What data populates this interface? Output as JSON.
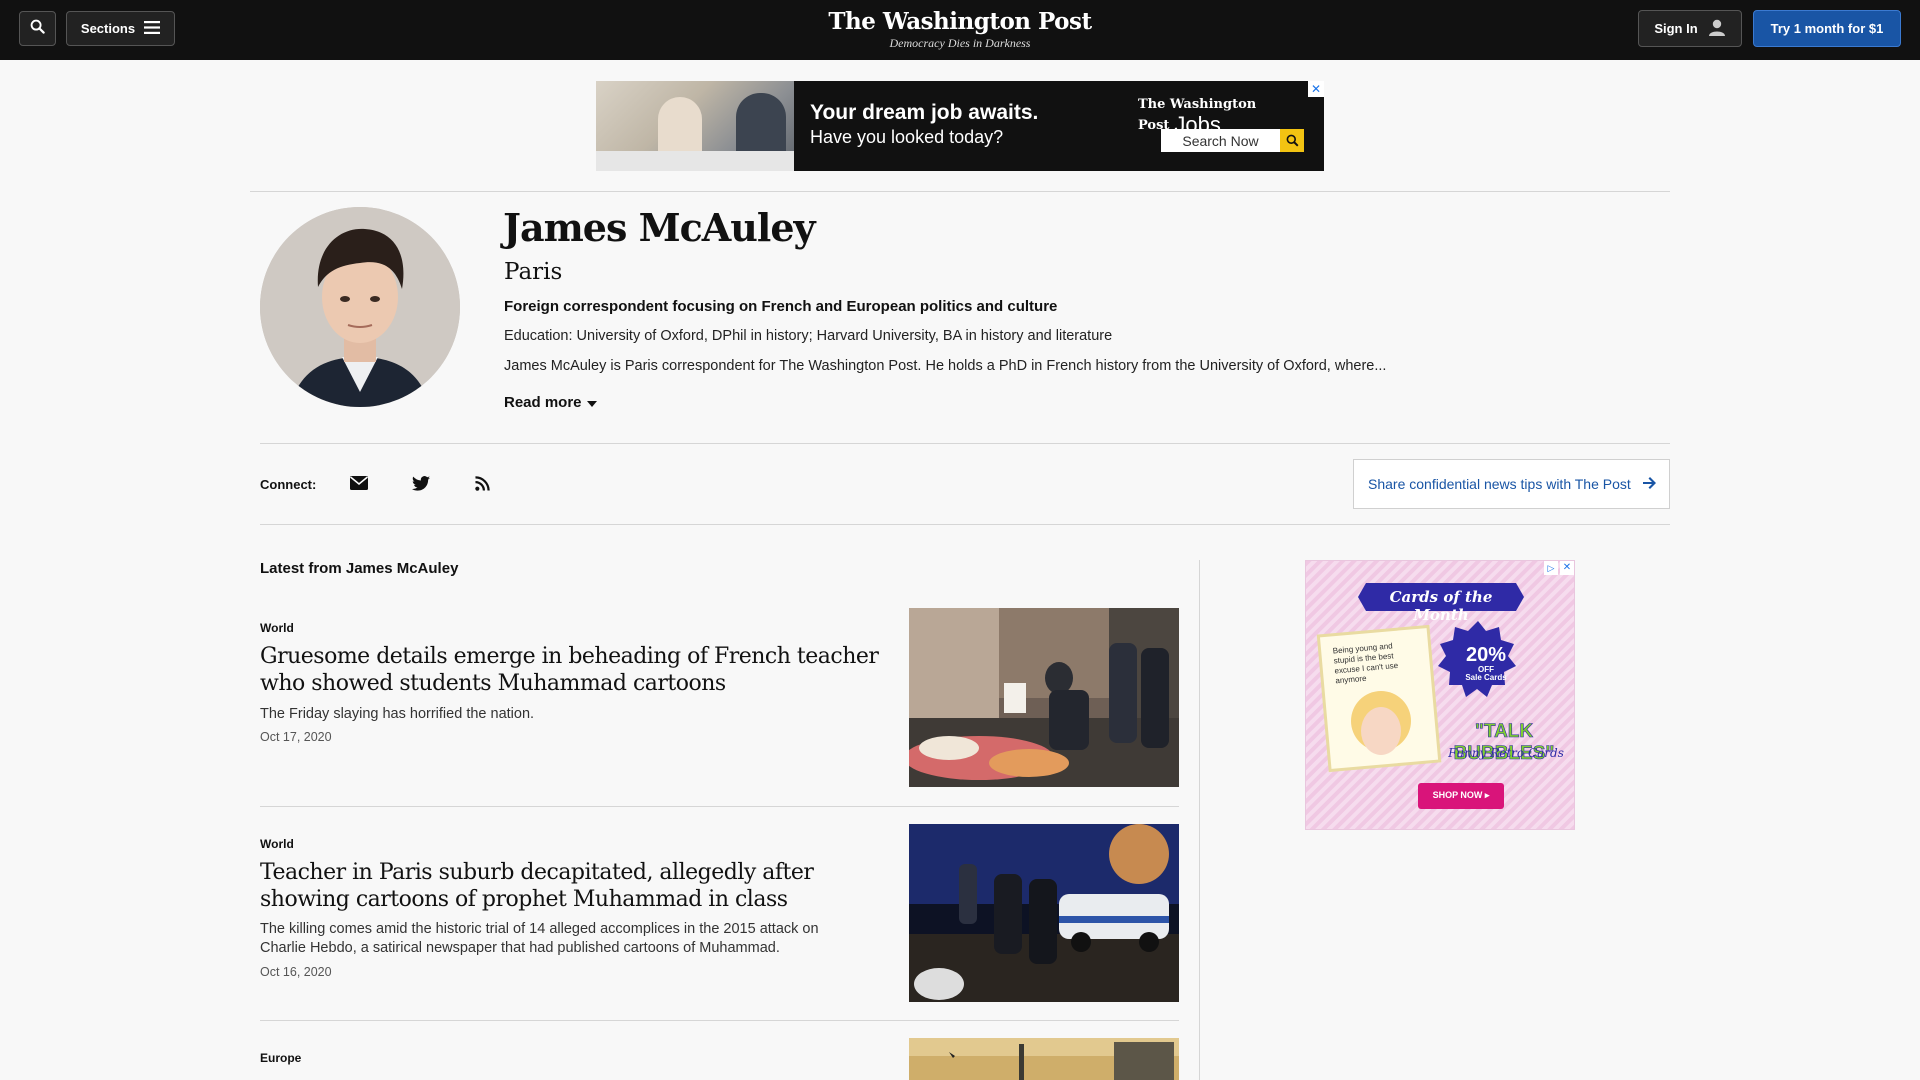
{
  "header": {
    "sections_label": "Sections",
    "logo_name": "The Washington Post",
    "tagline": "Democracy Dies in Darkness",
    "signin_label": "Sign In",
    "try_label": "Try 1 month for $1"
  },
  "top_ad": {
    "headline": "Your dream job awaits.",
    "subline": "Have you looked today?",
    "brand": "The Washington Post",
    "brand_suffix": "Jobs",
    "search_label": "Search Now",
    "close": "✕"
  },
  "author": {
    "name": "James McAuley",
    "location": "Paris",
    "beat": "Foreign correspondent focusing on French and European politics and culture",
    "education": "Education: University of Oxford, DPhil in history; Harvard University, BA in history and literature",
    "bio": "James McAuley is Paris correspondent for The Washington Post. He holds a PhD in French history from the University of Oxford, where...",
    "read_more": "Read more"
  },
  "connect": {
    "label": "Connect:",
    "icons": [
      "email-icon",
      "twitter-icon",
      "rss-icon"
    ],
    "tips_label": "Share confidential news tips with The Post"
  },
  "latest": {
    "heading": "Latest from James McAuley",
    "articles": [
      {
        "kicker": "World",
        "headline": "Gruesome details emerge in beheading of French teacher who showed students Muhammad cartoons",
        "blurb": "The Friday slaying has horrified the nation.",
        "date": "Oct 17, 2020"
      },
      {
        "kicker": "World",
        "headline": "Teacher in Paris suburb decapitated, allegedly after showing cartoons of prophet Muhammad in class",
        "blurb": "The killing comes amid the historic trial of 14 alleged accomplices in the 2015 attack on Charlie Hebdo, a satirical newspaper that had published cartoons of Muhammad.",
        "date": "Oct 16, 2020"
      },
      {
        "kicker": "Europe",
        "headline": "",
        "blurb": "",
        "date": ""
      }
    ]
  },
  "side_ad": {
    "title": "Cards of the Month",
    "card_text": "Being young and stupid is the best excuse I can't use anymore",
    "badge_pct": "20%",
    "badge_off": "OFF",
    "badge_sub": "Sale Cards",
    "brand": "\"TALK BUBBLES\"",
    "brand_sub": "Funny Retro Cards",
    "cta": "SHOP NOW ▸"
  },
  "colors": {
    "nav_bg": "#111111",
    "accent_blue": "#1955a5",
    "page_bg": "#f8f8f8"
  }
}
